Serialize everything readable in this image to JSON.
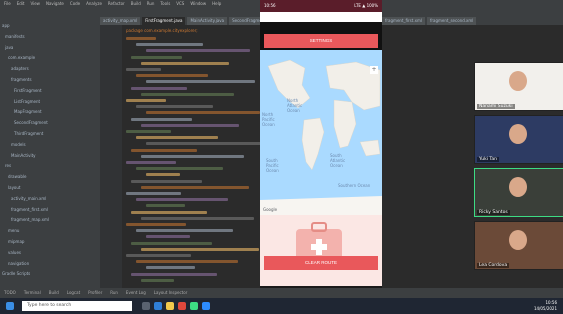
{
  "ide": {
    "menus": [
      "File",
      "Edit",
      "View",
      "Navigate",
      "Code",
      "Analyze",
      "Refactor",
      "Build",
      "Run",
      "Tools",
      "VCS",
      "Window",
      "Help"
    ],
    "editor_tabs": [
      "activity_map.xml",
      "FirstFragment.java",
      "MainActivity.java",
      "SecondFragment.java"
    ],
    "right_tabs": [
      "fragment_first.xml",
      "fragment_second.xml"
    ],
    "project_tree": [
      "app",
      "manifests",
      "java",
      "com.example",
      "adapters",
      "fragments",
      "FirstFragment",
      "ListFragment",
      "MapFragment",
      "SecondFragment",
      "ThirdFragment",
      "models",
      "MainActivity",
      "res",
      "drawable",
      "layout",
      "activity_main.xml",
      "fragment_first.xml",
      "fragment_map.xml",
      "menu",
      "mipmap",
      "values",
      "navigation",
      "Gradle Scripts"
    ],
    "code_head": "package com.example.cityexplorer;",
    "bottom_tools": [
      "TODO",
      "Terminal",
      "Build",
      "Logcat",
      "Profiler",
      "Run",
      "Event Log",
      "Layout Inspector"
    ]
  },
  "phone": {
    "status_time": "10:56",
    "status_right": "LTE ▲ 100%",
    "top_button": "SETTINGS",
    "bottom_button": "CLEAR ROUTE",
    "map_labels": [
      "North Atlantic Ocean",
      "South Atlantic Ocean",
      "Southern Ocean",
      "North Pacific Ocean",
      "South Pacific Ocean"
    ],
    "map_brand": "Google"
  },
  "meeting": {
    "participants": [
      {
        "name": "Nanami Suzuki",
        "bg": "#f2f0ec"
      },
      {
        "name": "Yuki Tan",
        "bg": "#2d3b63"
      },
      {
        "name": "Ricky Santos",
        "bg": "#3a3f39"
      },
      {
        "name": "Lea Cordova",
        "bg": "#6b4a38"
      }
    ]
  },
  "taskbar": {
    "search_placeholder": "Type here to search",
    "time": "10:56",
    "date": "14/05/2021"
  }
}
